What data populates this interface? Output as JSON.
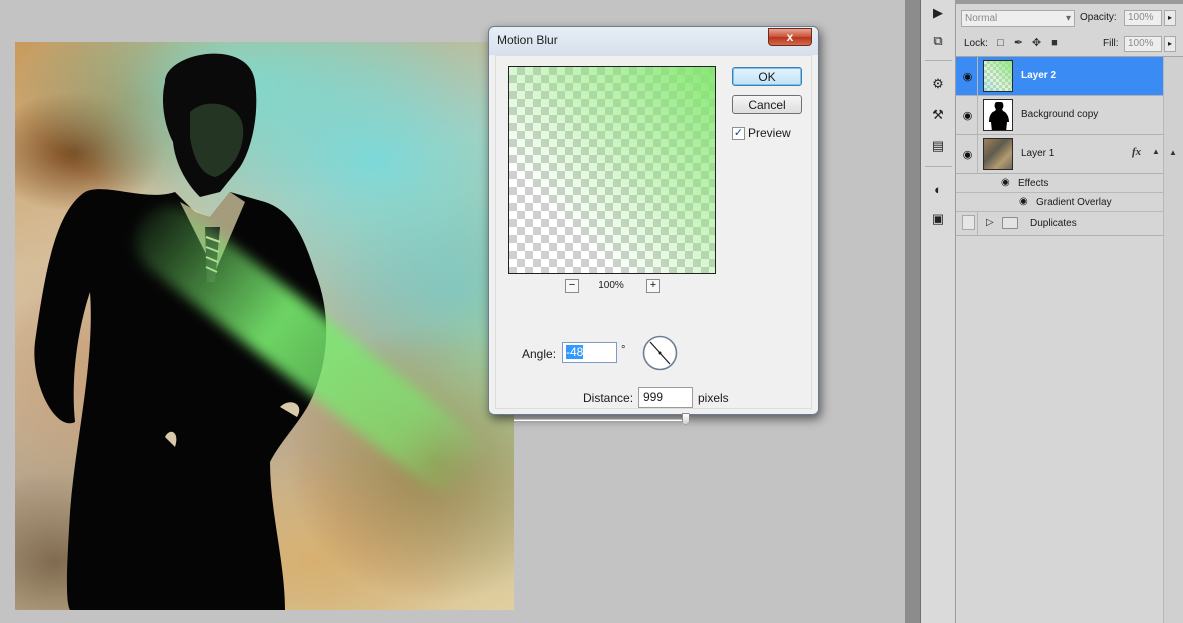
{
  "dialog": {
    "title": "Motion Blur",
    "close_label": "x",
    "ok_label": "OK",
    "cancel_label": "Cancel",
    "preview_label": "Preview",
    "preview_checked": true,
    "zoom_out_label": "−",
    "zoom_in_label": "+",
    "zoom_level": "100%",
    "angle_label": "Angle:",
    "angle_value": "-48",
    "degree_symbol": "°",
    "distance_label": "Distance:",
    "distance_value": "999",
    "distance_unit": "pixels",
    "distance_slider_fraction": 0.98
  },
  "layers_panel": {
    "blend_mode": "Normal",
    "opacity_label": "Opacity:",
    "opacity_value": "100%",
    "lock_label": "Lock:",
    "fill_label": "Fill:",
    "fill_value": "100%",
    "layers": [
      {
        "name": "Layer 2",
        "selected": true,
        "visible": true
      },
      {
        "name": "Background copy",
        "selected": false,
        "visible": true
      },
      {
        "name": "Layer 1",
        "selected": false,
        "visible": true,
        "fx": "fx"
      }
    ],
    "effects_label": "Effects",
    "effect_items": [
      "Gradient Overlay"
    ],
    "group": {
      "name": "Duplicates",
      "visible": false,
      "expanded": false
    }
  },
  "colors": {
    "selected_layer": "#3b8bf4",
    "dialog_close": "#c94f35",
    "beam_green": "#78eb6e",
    "haze_cyan": "#6edce1"
  },
  "icons": {
    "dock": [
      "play-icon",
      "clone-source-icon",
      "brush-presets-icon",
      "tool-presets-icon",
      "stamp-icon",
      "adjustments-icon",
      "masks-icon"
    ],
    "lock": [
      "lock-transparent-icon",
      "lock-paint-icon",
      "lock-move-icon",
      "lock-all-icon"
    ]
  }
}
